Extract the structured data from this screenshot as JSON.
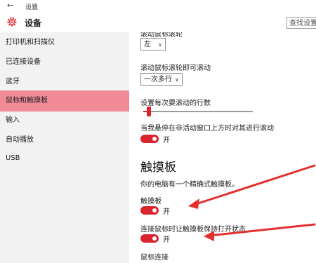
{
  "titlebar": {
    "back_glyph": "←",
    "title": "设置"
  },
  "header": {
    "icon": "gear-icon",
    "title": "设备",
    "search_text": "查找设置"
  },
  "sidebar": {
    "items": [
      {
        "label": "打印机和扫描仪"
      },
      {
        "label": "已连接设备"
      },
      {
        "label": "蓝牙"
      },
      {
        "label": "鼠标和触摸板",
        "active": true
      },
      {
        "label": "输入"
      },
      {
        "label": "自动播放"
      },
      {
        "label": "USB"
      }
    ]
  },
  "main": {
    "top_cut_label": "滚动鼠标滚轮",
    "roll_value": "左",
    "wheel_label": "滚动鼠标滚轮即可滚动",
    "wheel_value": "一次多行",
    "lines_label": "设置每次要滚动的行数",
    "lines_level": 0.03,
    "inactive_label": "当我悬停在非活动窗口上方时对其进行滚动",
    "inactive_state": "开",
    "touchpad_heading": "触摸板",
    "touchpad_desc": "你的电脑有一个精确式触摸板。",
    "touchpad_label": "触摸板",
    "touchpad_state": "开",
    "mouse_connect_label": "连接鼠标时让触摸板保持打开状态",
    "mouse_connect_state": "开",
    "bottom_cut_label": "鼠标连接"
  },
  "colors": {
    "accent": "#d9232d",
    "active_nav": "#f08a95",
    "sidebar_bg": "#f2f2f2"
  }
}
